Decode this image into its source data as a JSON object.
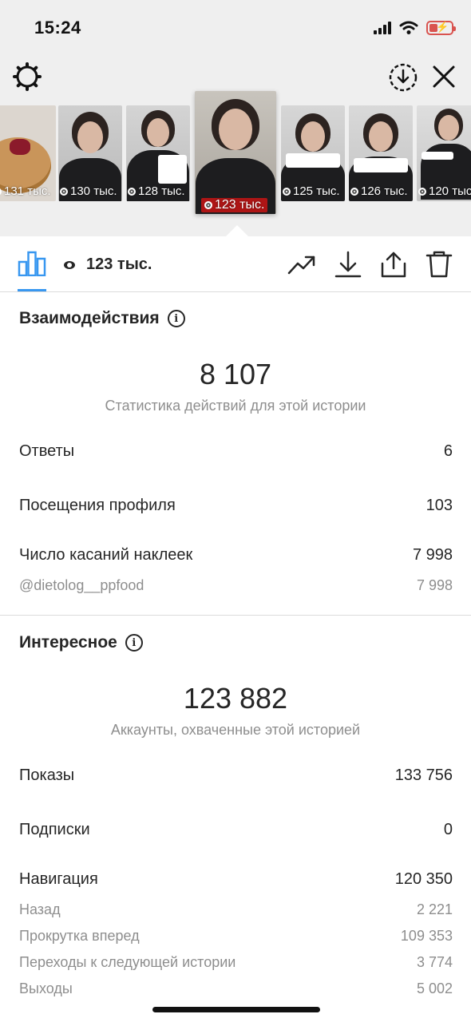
{
  "status_bar": {
    "time": "15:24"
  },
  "colors": {
    "accent": "#3897f0",
    "text": "#262626",
    "muted": "#8e8e8e",
    "battery": "#d9534f"
  },
  "icons": {
    "settings": "gear-icon",
    "download_circle": "download-circle-icon",
    "close": "close-icon",
    "insights": "bar-chart-icon",
    "views": "eye-icon",
    "promote": "trending-up-icon",
    "download": "download-icon",
    "share": "share-icon",
    "delete": "trash-icon",
    "info": "info-icon"
  },
  "stories": [
    {
      "views": "131 тыс."
    },
    {
      "views": "130 тыс."
    },
    {
      "views": "128 тыс."
    },
    {
      "views": "123 тыс.",
      "selected": true
    },
    {
      "views": "125 тыс."
    },
    {
      "views": "126 тыс."
    },
    {
      "views": "120 тыс."
    }
  ],
  "toolbar": {
    "views": "123 тыс."
  },
  "interactions": {
    "title": "Взаимодействия",
    "total": "8 107",
    "caption": "Статистика действий для этой истории",
    "rows": [
      {
        "label": "Ответы",
        "value": "6"
      },
      {
        "label": "Посещения профиля",
        "value": "103"
      },
      {
        "label": "Число касаний наклеек",
        "value": "7 998"
      }
    ],
    "sub_rows": [
      {
        "label": "@dietolog__ppfood",
        "value": "7 998"
      }
    ]
  },
  "discovery": {
    "title": "Интересное",
    "total": "123 882",
    "caption": "Аккаунты, охваченные этой историей",
    "rows": [
      {
        "label": "Показы",
        "value": "133 756"
      },
      {
        "label": "Подписки",
        "value": "0"
      },
      {
        "label": "Навигация",
        "value": "120 350"
      }
    ],
    "sub_rows": [
      {
        "label": "Назад",
        "value": "2 221"
      },
      {
        "label": "Прокрутка вперед",
        "value": "109 353"
      },
      {
        "label": "Переходы к следующей истории",
        "value": "3 774"
      },
      {
        "label": "Выходы",
        "value": "5 002"
      }
    ]
  }
}
